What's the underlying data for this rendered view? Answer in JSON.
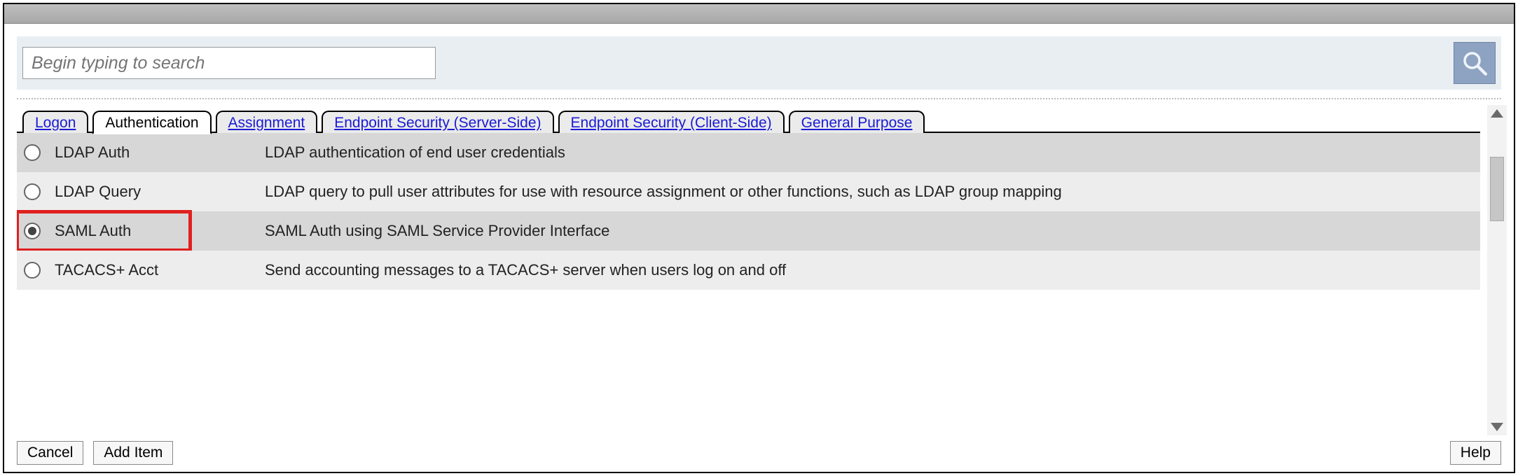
{
  "search": {
    "placeholder": "Begin typing to search"
  },
  "tabs": [
    {
      "label": "Logon",
      "active": false
    },
    {
      "label": "Authentication",
      "active": true
    },
    {
      "label": "Assignment",
      "active": false
    },
    {
      "label": "Endpoint Security (Server-Side)",
      "active": false
    },
    {
      "label": "Endpoint Security (Client-Side)",
      "active": false
    },
    {
      "label": "General Purpose",
      "active": false
    }
  ],
  "items": [
    {
      "name": "LDAP Auth",
      "desc": "LDAP authentication of end user credentials",
      "selected": false,
      "highlighted": false
    },
    {
      "name": "LDAP Query",
      "desc": "LDAP query to pull user attributes for use with resource assignment or other functions, such as LDAP group mapping",
      "selected": false,
      "highlighted": false
    },
    {
      "name": "SAML Auth",
      "desc": "SAML Auth using SAML Service Provider Interface",
      "selected": true,
      "highlighted": true
    },
    {
      "name": "TACACS+ Acct",
      "desc": "Send accounting messages to a TACACS+ server when users log on and off",
      "selected": false,
      "highlighted": false
    }
  ],
  "buttons": {
    "cancel": "Cancel",
    "add_item": "Add Item",
    "help": "Help"
  }
}
